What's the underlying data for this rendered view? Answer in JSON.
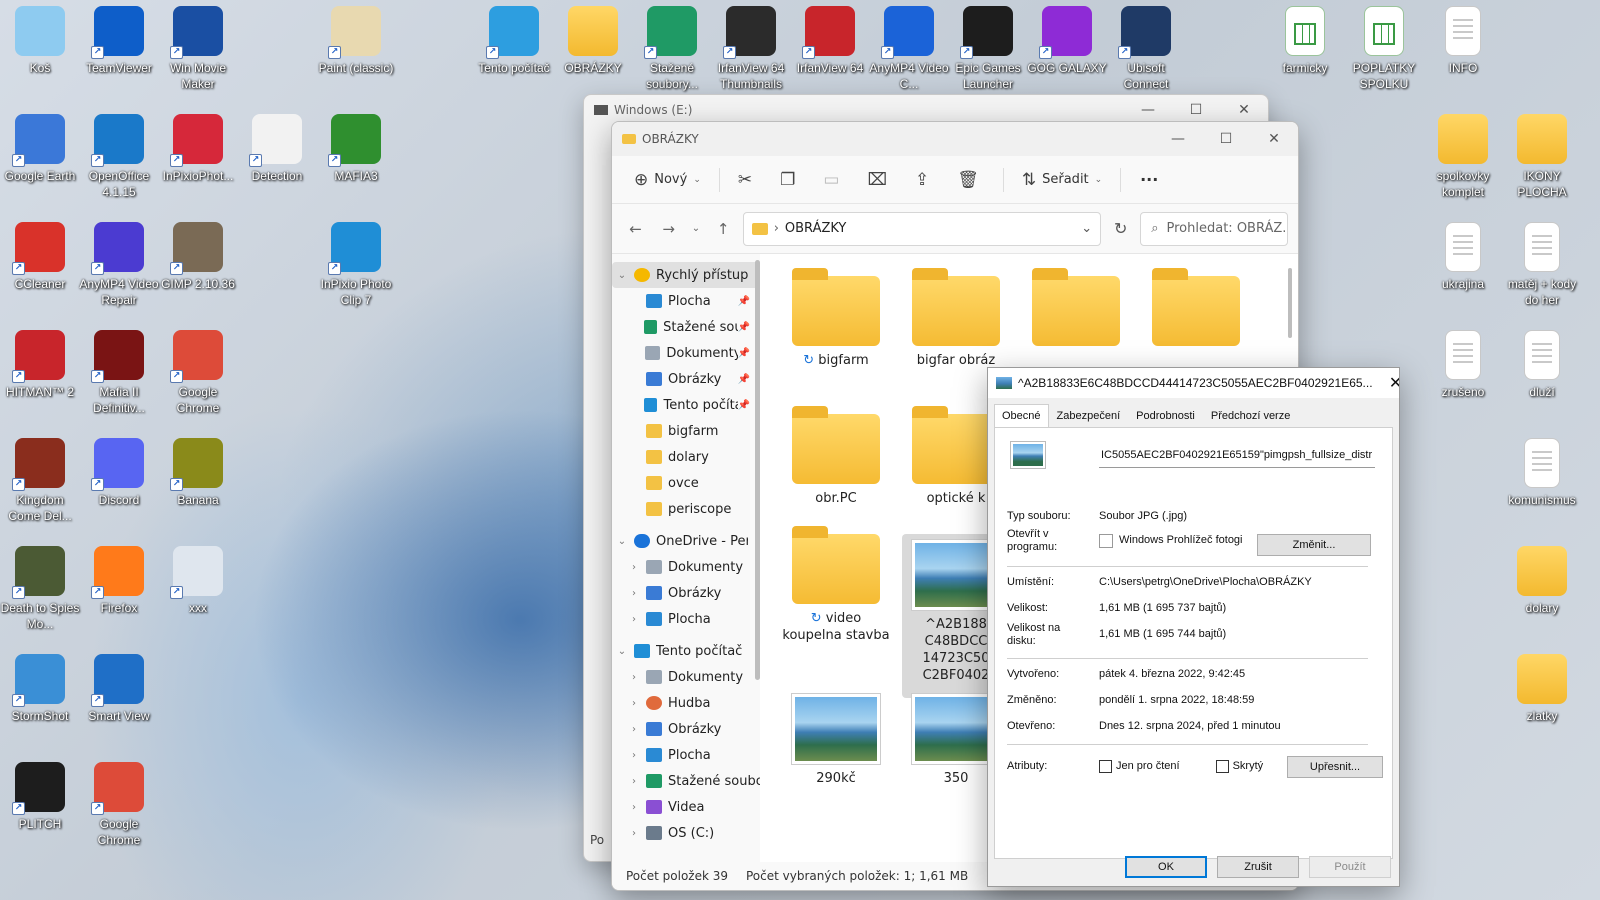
{
  "desktop": {
    "icons": [
      {
        "label": "Koš",
        "color": "#8ecbf0"
      },
      {
        "label": "TeamViewer",
        "color": "#0e5ec9"
      },
      {
        "label": "Win Movie Maker",
        "color": "#1a4fa3"
      },
      {
        "label": "Paint (classic)",
        "color": "#e8d9b0"
      },
      {
        "label": "Tento počítač",
        "color": "#2d9ee0"
      },
      {
        "label": "OBRÁZKY",
        "color": "#f3c244"
      },
      {
        "label": "Stažené soubory...",
        "color": "#1f9a65"
      },
      {
        "label": "IrfanView 64 Thumbnails",
        "color": "#2b2b2b"
      },
      {
        "label": "IrfanView 64",
        "color": "#c8252b"
      },
      {
        "label": "AnyMP4 Video C...",
        "color": "#1b63d8"
      },
      {
        "label": "Epic Games Launcher",
        "color": "#1d1d1d"
      },
      {
        "label": "GOG GALAXY",
        "color": "#8e2bd6"
      },
      {
        "label": "Ubisoft Connect",
        "color": "#1f3a66"
      },
      {
        "label": "farmicky",
        "color": "#3a9a44"
      },
      {
        "label": "POPLATKY SPOLKU",
        "color": "#3a9a44"
      },
      {
        "label": "INFO",
        "color": "#ffffff"
      },
      {
        "label": "Google Earth",
        "color": "#3b78d8"
      },
      {
        "label": "OpenOffice 4.1.15",
        "color": "#1a79c9"
      },
      {
        "label": "InPixioPhot...",
        "color": "#d6283a"
      },
      {
        "label": "Detection",
        "color": "#f2f2f2"
      },
      {
        "label": "MAFIA3",
        "color": "#2f8f2f"
      },
      {
        "label": "spolkovky komplet",
        "color": "#f3c244"
      },
      {
        "label": "IKONY PLOCHA",
        "color": "#f3c244"
      },
      {
        "label": "CCleaner",
        "color": "#d9322a"
      },
      {
        "label": "AnyMP4 Video Repair",
        "color": "#4b3bd1"
      },
      {
        "label": "GIMP 2.10.36",
        "color": "#7a6a55"
      },
      {
        "label": "InPixio Photo Clip 7",
        "color": "#1f8ed6"
      },
      {
        "label": "ukrajina",
        "color": "#ffffff"
      },
      {
        "label": "matěj + kody do her",
        "color": "#ffffff"
      },
      {
        "label": "HITMAN™ 2",
        "color": "#c8252b"
      },
      {
        "label": "Mafia II Definitiv...",
        "color": "#7a1414"
      },
      {
        "label": "Google Chrome",
        "color": "#dd4b39"
      },
      {
        "label": "zrušeno",
        "color": "#ffffff"
      },
      {
        "label": "dluží",
        "color": "#ffffff"
      },
      {
        "label": "Kingdom Come Del...",
        "color": "#8a2d1d"
      },
      {
        "label": "Discord",
        "color": "#5865f2"
      },
      {
        "label": "Banana",
        "color": "#8a8a1a"
      },
      {
        "label": "komunismus",
        "color": "#ffffff"
      },
      {
        "label": "Death to Spies Mo...",
        "color": "#4b5a34"
      },
      {
        "label": "Firefox",
        "color": "#ff7a1a"
      },
      {
        "label": "xxx",
        "color": "#dfe6ee"
      },
      {
        "label": "dolary",
        "color": "#f3c244"
      },
      {
        "label": "StormShot",
        "color": "#3a8fd6"
      },
      {
        "label": "Smart View",
        "color": "#1f6fc7"
      },
      {
        "label": "zlatky",
        "color": "#f3c244"
      },
      {
        "label": "PLITCH",
        "color": "#1d1d1d"
      },
      {
        "label": "Google Chrome",
        "color": "#dd4b39"
      }
    ]
  },
  "back_window": {
    "title": "Windows (E:)",
    "partial_labels": [
      "Po"
    ]
  },
  "explorer": {
    "title": "OBRÁZKY",
    "toolbar": {
      "new_label": "Nový",
      "sort_label": "Seřadit",
      "more_label": "···"
    },
    "address": {
      "crumb": "OBRÁZKY"
    },
    "search_placeholder": "Prohledat: OBRÁZ...",
    "nav": [
      {
        "label": "Rychlý přístup",
        "chev": "⌄",
        "icon": "star",
        "indent": 0,
        "pin": false,
        "selected": true
      },
      {
        "label": "Plocha",
        "chev": "",
        "icon": "blue",
        "indent": 1,
        "pin": true
      },
      {
        "label": "Stažené soub",
        "chev": "",
        "icon": "down",
        "indent": 1,
        "pin": true
      },
      {
        "label": "Dokumenty",
        "chev": "",
        "icon": "doc",
        "indent": 1,
        "pin": true
      },
      {
        "label": "Obrázky",
        "chev": "",
        "icon": "img",
        "indent": 1,
        "pin": true
      },
      {
        "label": "Tento počítač",
        "chev": "",
        "icon": "pc",
        "indent": 1,
        "pin": true
      },
      {
        "label": "bigfarm",
        "chev": "",
        "icon": "folder",
        "indent": 1,
        "pin": false
      },
      {
        "label": "dolary",
        "chev": "",
        "icon": "folder",
        "indent": 1,
        "pin": false
      },
      {
        "label": "ovce",
        "chev": "",
        "icon": "folder",
        "indent": 1,
        "pin": false
      },
      {
        "label": "periscope",
        "chev": "",
        "icon": "folder",
        "indent": 1,
        "pin": false
      },
      {
        "label": "OneDrive - Person",
        "chev": "⌄",
        "icon": "cloud",
        "indent": 0,
        "pin": false
      },
      {
        "label": "Dokumenty",
        "chev": "›",
        "icon": "doc",
        "indent": 1,
        "pin": false
      },
      {
        "label": "Obrázky",
        "chev": "›",
        "icon": "img",
        "indent": 1,
        "pin": false
      },
      {
        "label": "Plocha",
        "chev": "›",
        "icon": "blue",
        "indent": 1,
        "pin": false
      },
      {
        "label": "Tento počítač",
        "chev": "⌄",
        "icon": "pc",
        "indent": 0,
        "pin": false
      },
      {
        "label": "Dokumenty",
        "chev": "›",
        "icon": "doc",
        "indent": 1,
        "pin": false
      },
      {
        "label": "Hudba",
        "chev": "›",
        "icon": "music",
        "indent": 1,
        "pin": false
      },
      {
        "label": "Obrázky",
        "chev": "›",
        "icon": "img",
        "indent": 1,
        "pin": false
      },
      {
        "label": "Plocha",
        "chev": "›",
        "icon": "blue",
        "indent": 1,
        "pin": false
      },
      {
        "label": "Stažené soubory",
        "chev": "›",
        "icon": "down",
        "indent": 1,
        "pin": false
      },
      {
        "label": "Videa",
        "chev": "›",
        "icon": "video",
        "indent": 1,
        "pin": false
      },
      {
        "label": "OS (C:)",
        "chev": "›",
        "icon": "drive",
        "indent": 1,
        "pin": false
      }
    ],
    "items": [
      {
        "label": "bigfarm",
        "kind": "folder",
        "sync": true
      },
      {
        "label": "bigfar obráz",
        "kind": "folder",
        "sync": false
      },
      {
        "label": "",
        "kind": "folder",
        "sync": false
      },
      {
        "label": "",
        "kind": "folder",
        "sync": false
      },
      {
        "label": "obr.PC",
        "kind": "folder",
        "sync": false
      },
      {
        "label": "optické k",
        "kind": "folder",
        "sync": false
      },
      {
        "label": "video koupelna stavba",
        "kind": "folder",
        "sync": true
      },
      {
        "label": "^A2B188 C48BDCC 14723C50 C2BF0402",
        "kind": "image",
        "sync": false,
        "selected": true
      },
      {
        "label": "290kč",
        "kind": "image",
        "sync": false
      },
      {
        "label": "350",
        "kind": "image",
        "sync": false
      }
    ],
    "status": {
      "count": "Počet položek 39",
      "selected": "Počet vybraných položek: 1; 1,61 MB"
    }
  },
  "properties": {
    "title": "^A2B18833E6C48BDCCD44414723C5055AEC2BF0402921E65...",
    "tabs": [
      "Obecné",
      "Zabezpečení",
      "Podrobnosti",
      "Předchozí verze"
    ],
    "filename": "IC5055AEC2BF0402921E65159\"pimgpsh_fullsize_distr",
    "rows": {
      "type_k": "Typ souboru:",
      "type_v": "Soubor JPG (.jpg)",
      "open_k": "Otevřít v programu:",
      "open_v": "Windows Prohlížeč fotogi",
      "change_btn": "Změnit...",
      "loc_k": "Umístění:",
      "loc_v": "C:\\Users\\petrg\\OneDrive\\Plocha\\OBRÁZKY",
      "size_k": "Velikost:",
      "size_v": "1,61 MB (1 695 737 bajtů)",
      "disk_k": "Velikost na disku:",
      "disk_v": "1,61 MB (1 695 744 bajtů)",
      "created_k": "Vytvořeno:",
      "created_v": "pátek 4. března 2022, 9:42:45",
      "modified_k": "Změněno:",
      "modified_v": "pondělí 1. srpna 2022, 18:48:59",
      "opened_k": "Otevřeno:",
      "opened_v": "Dnes 12. srpna 2024, před 1 minutou",
      "attr_k": "Atributy:",
      "readonly": "Jen pro čtení",
      "hidden": "Skrytý",
      "advanced_btn": "Upřesnit..."
    },
    "buttons": {
      "ok": "OK",
      "cancel": "Zrušit",
      "apply": "Použít"
    }
  }
}
